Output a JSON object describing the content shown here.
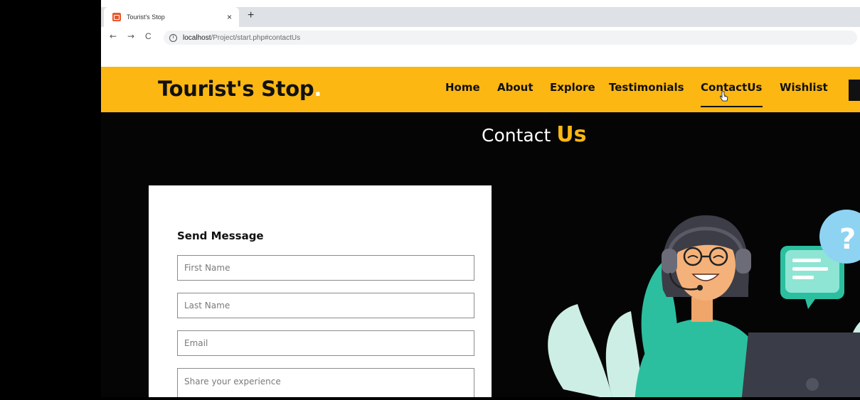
{
  "browser": {
    "tab_title": "Tourist's Stop",
    "tab_close": "×",
    "new_tab": "+",
    "back": "←",
    "forward": "→",
    "reload": "C",
    "info_icon": "i",
    "url_host": "localhost",
    "url_path": "/Project/start.php#contactUs"
  },
  "header": {
    "logo_text": "Tourist's Stop",
    "logo_dot": ".",
    "nav": [
      {
        "label": "Home"
      },
      {
        "label": "About"
      },
      {
        "label": "Explore"
      },
      {
        "label": "Testimonials"
      },
      {
        "label": "ContactUs"
      },
      {
        "label": "Wishlist"
      }
    ],
    "active_nav": "ContactUs"
  },
  "contact": {
    "title_prefix": "Contact",
    "title_accent": "Us",
    "form_heading": "Send Message",
    "fields": {
      "first_name_placeholder": "First Name",
      "last_name_placeholder": "Last Name",
      "email_placeholder": "Email",
      "experience_placeholder": "Share your experience"
    }
  },
  "colors": {
    "brand_yellow": "#fcb712",
    "dark_bg": "#050505",
    "teal": "#2bbf9f",
    "mint": "#cdeee5",
    "bubble_blue": "#8ed3f2"
  },
  "icons": [
    "browser-favicon",
    "info-icon",
    "pointer-cursor-icon",
    "question-mark-icon"
  ]
}
